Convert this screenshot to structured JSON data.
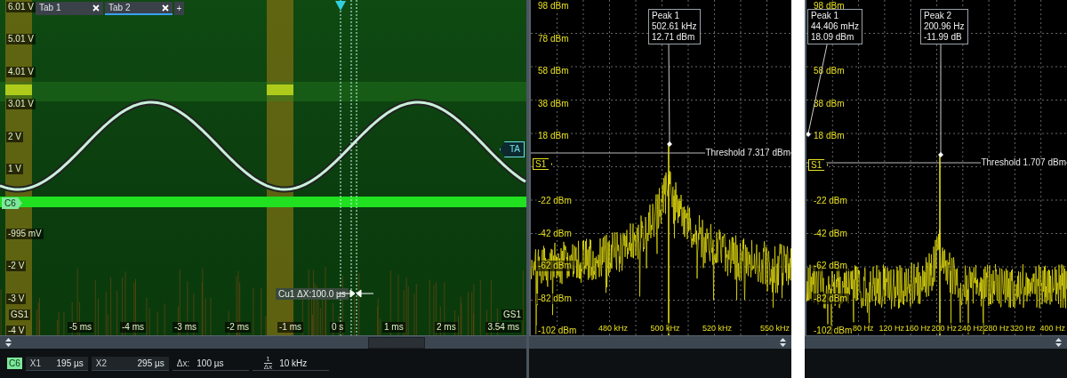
{
  "tabs": [
    {
      "label": "Tab 1",
      "selected": false
    },
    {
      "label": "Tab 2",
      "selected": true
    }
  ],
  "add_tab": "+",
  "waveform": {
    "y_top_label": "6.01 V",
    "y_labels_above_marker": [
      "5.01 V",
      "4.01 V",
      "3.01 V",
      "2 V",
      "1 V"
    ],
    "y_labels_below_marker": [
      "-995 mV",
      "-2 V",
      "-3 V",
      "-4 V"
    ],
    "x_labels": [
      "-5 ms",
      "-4 ms",
      "-3 ms",
      "-2 ms",
      "-1 ms",
      "0 s",
      "1 ms",
      "2 ms",
      "3.54 ms"
    ],
    "channel_marker": "C6",
    "trigger_marker": "TA",
    "gs_labels": [
      "GS1",
      "GS1"
    ],
    "cursor_readout": "Cu1 ΔX:100.0 µs"
  },
  "spectra": [
    {
      "y_top_label": "98 dBm",
      "y_labels_above_marker": [
        "78 dBm",
        "58 dBm",
        "38 dBm",
        "18 dBm"
      ],
      "y_labels_below_marker": [
        "-22 dBm",
        "-42 dBm",
        "-62 dBm",
        "-82 dBm",
        "-102 dBm"
      ],
      "x_labels": [
        "480 kHz",
        "500 kHz",
        "520 kHz",
        "550 kHz"
      ],
      "source": "S1",
      "threshold": "Threshold 7.317 dBm",
      "peaks": [
        {
          "lines": [
            "Peak 1",
            "502.61 kHz",
            "12.71 dBm"
          ]
        }
      ]
    },
    {
      "y_top_label": "98 dBm",
      "y_labels_above_marker": [
        "58 dBm",
        "38 dBm",
        "18 dBm"
      ],
      "y_labels_below_marker": [
        "-22 dBm",
        "-42 dBm",
        "-62 dBm",
        "-82 dBm",
        "-102 dBm"
      ],
      "x_labels": [
        "80 Hz",
        "120 Hz",
        "160 Hz",
        "200 Hz",
        "240 Hz",
        "280 Hz",
        "320 Hz",
        "400 Hz"
      ],
      "source": "S1",
      "threshold": "Threshold 1.707 dBm",
      "peaks": [
        {
          "lines": [
            "Peak 1",
            "44.406 mHz",
            "18.09 dBm"
          ]
        },
        {
          "lines": [
            "Peak 2",
            "200.96 Hz",
            "-11.99 dB"
          ]
        }
      ]
    }
  ],
  "cursor_bar": {
    "channel": "C6",
    "fields": [
      {
        "label": "X1",
        "value": "195 µs"
      },
      {
        "label": "X2",
        "value": "295 µs"
      }
    ],
    "delta": {
      "label": "Δx:",
      "value": "100 µs"
    },
    "inverse": {
      "numerator": "1",
      "denominator": "Δx",
      "value": "10 kHz"
    }
  }
}
